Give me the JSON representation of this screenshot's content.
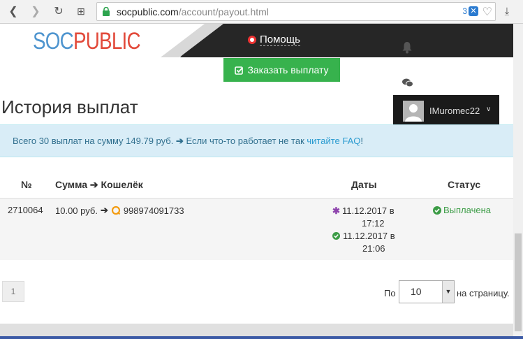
{
  "browser": {
    "url_domain": "socpublic.com",
    "url_path": "/account/payout.html",
    "extension_badge": "3"
  },
  "header": {
    "logo_part1": "SOC",
    "logo_part2": "PUBLIC",
    "help_label": "Помощь",
    "username": "IMuromec22"
  },
  "main": {
    "order_button": "Заказать выплату",
    "title": "История выплат",
    "info_text": "Всего 30 выплат на сумму 149.79 руб.",
    "info_text2": "Если что-то работает не так",
    "info_link": "читайте FAQ",
    "info_end": "!"
  },
  "table": {
    "headers": {
      "num": "№",
      "amount": "Сумма",
      "wallet": "Кошелёк",
      "dates": "Даты",
      "status": "Статус"
    },
    "rows": [
      {
        "id": "2710064",
        "amount": "10.00 руб.",
        "wallet": "998974091733",
        "date1_line1": "11.12.2017 в",
        "date1_line2": "17:12",
        "date2_line1": "11.12.2017 в",
        "date2_line2": "21:06",
        "status": "Выплачена"
      }
    ]
  },
  "pagination": {
    "current_page": "1",
    "per_label": "По",
    "per_value": "10",
    "per_suffix": "на страницу."
  },
  "colors": {
    "accent_green": "#37b24d",
    "header_dark": "#262626",
    "info_bg": "#d9edf7",
    "logo_blue": "#4f95cf",
    "logo_red": "#e24a3b"
  }
}
